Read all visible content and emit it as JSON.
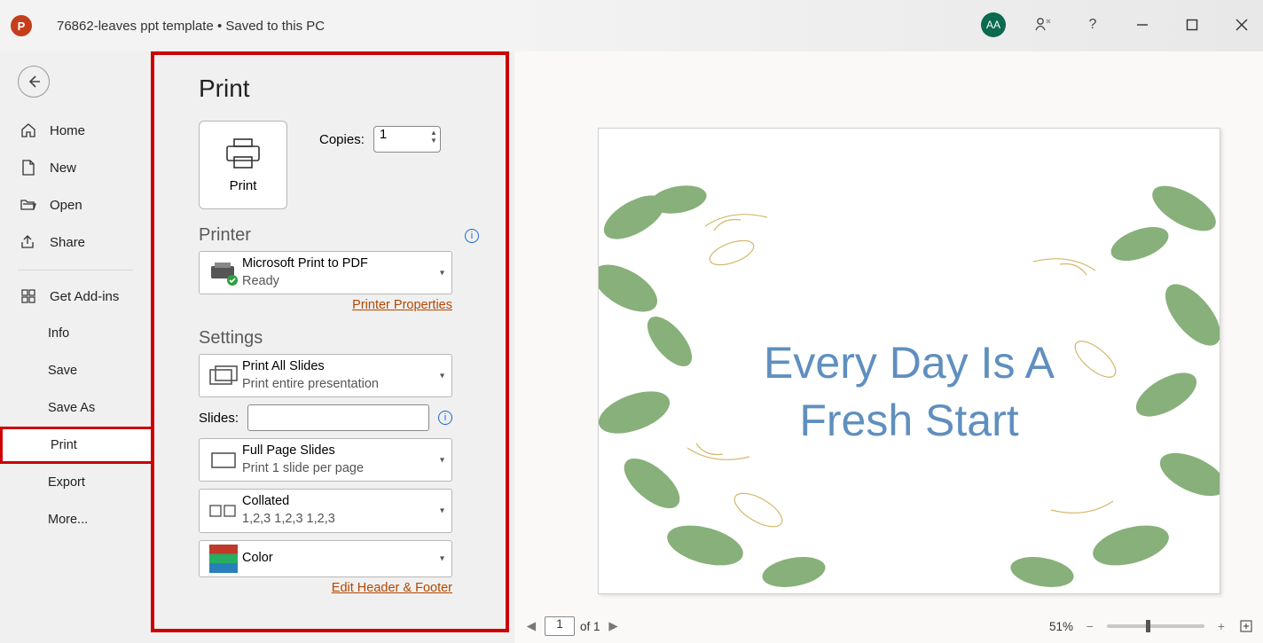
{
  "titlebar": {
    "app_letter": "P",
    "title": "76862-leaves ppt template • Saved to this PC",
    "avatar": "AA"
  },
  "nav": {
    "home": "Home",
    "new": "New",
    "open": "Open",
    "share": "Share",
    "addins": "Get Add-ins",
    "info": "Info",
    "save": "Save",
    "saveas": "Save As",
    "print": "Print",
    "export": "Export",
    "more": "More..."
  },
  "print": {
    "heading": "Print",
    "print_btn": "Print",
    "copies_label": "Copies:",
    "copies_value": "1",
    "printer_h": "Printer",
    "printer_name": "Microsoft Print to PDF",
    "printer_status": "Ready",
    "printer_props": "Printer Properties",
    "settings_h": "Settings",
    "range_title": "Print All Slides",
    "range_sub": "Print entire presentation",
    "slides_label": "Slides:",
    "layout_title": "Full Page Slides",
    "layout_sub": "Print 1 slide per page",
    "collate_title": "Collated",
    "collate_sub": "1,2,3    1,2,3    1,2,3",
    "color_title": "Color",
    "edit_hf": "Edit Header & Footer"
  },
  "preview": {
    "slide_line1": "Every Day Is A",
    "slide_line2": "Fresh Start",
    "page_current": "1",
    "page_total": "of  1",
    "zoom": "51%"
  }
}
